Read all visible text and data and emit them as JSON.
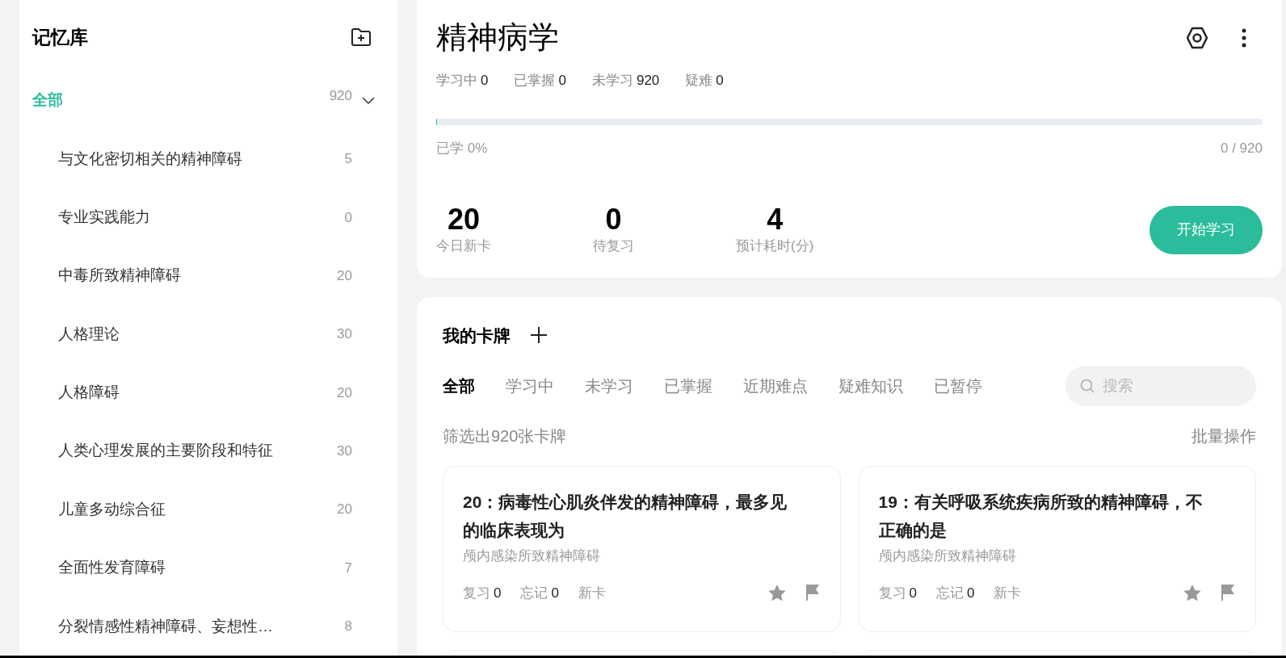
{
  "sidebar": {
    "title": "记忆库",
    "items": [
      {
        "label": "全部",
        "count": "920",
        "selected": true,
        "expanded": true,
        "children": [
          {
            "label": "与文化密切相关的精神障碍",
            "count": "5",
            "selected": false
          },
          {
            "label": "专业实践能力",
            "count": "0",
            "selected": false
          },
          {
            "label": "中毒所致精神障碍",
            "count": "20",
            "selected": false
          },
          {
            "label": "人格理论",
            "count": "30",
            "selected": false
          },
          {
            "label": "人格障碍",
            "count": "20",
            "selected": false
          },
          {
            "label": "人类心理发展的主要阶段和特征",
            "count": "30",
            "selected": false
          },
          {
            "label": "儿童多动综合征",
            "count": "20",
            "selected": false
          },
          {
            "label": "全面性发育障碍",
            "count": "7",
            "selected": false
          },
          {
            "label": "分裂情感性精神障碍、妄想性…",
            "count": "8",
            "selected": false
          }
        ]
      }
    ]
  },
  "deck": {
    "title": "精神病学",
    "stats": [
      {
        "label": "学习中",
        "value": "0"
      },
      {
        "label": "已掌握",
        "value": "0"
      },
      {
        "label": "未学习",
        "value": "920"
      },
      {
        "label": "疑难",
        "value": "0"
      }
    ],
    "progress": {
      "level": 0,
      "label": "已学 0%",
      "reading": "0 / 920"
    },
    "summary": [
      {
        "value": "20",
        "label": "今日新卡"
      },
      {
        "value": "0",
        "label": "待复习"
      },
      {
        "value": "4",
        "label": "预计耗时(分)"
      }
    ],
    "start_button": "开始学习"
  },
  "cards_panel": {
    "title": "我的卡牌",
    "tabs": [
      {
        "label": "全部",
        "selected": true
      },
      {
        "label": "学习中",
        "selected": false
      },
      {
        "label": "未学习",
        "selected": false
      },
      {
        "label": "已掌握",
        "selected": false
      },
      {
        "label": "近期难点",
        "selected": false
      },
      {
        "label": "疑难知识",
        "selected": false
      },
      {
        "label": "已暂停",
        "selected": false
      }
    ],
    "search": {
      "placeholder": "搜索"
    },
    "filter_text": "筛选出920张卡牌",
    "bulk_action": "批量操作",
    "cards": [
      {
        "title": "20：病毒性心肌炎伴发的精神障碍，最多见的临床表现为",
        "category": "颅内感染所致精神障碍",
        "stats": [
          {
            "label": "复习",
            "value": "0"
          },
          {
            "label": "忘记",
            "value": "0"
          }
        ],
        "status": "新卡",
        "starred": false,
        "flagged": false
      },
      {
        "title": "19：有关呼吸系统疾病所致的精神障碍，不正确的是",
        "category": "颅内感染所致精神障碍",
        "stats": [
          {
            "label": "复习",
            "value": "0"
          },
          {
            "label": "忘记",
            "value": "0"
          }
        ],
        "status": "新卡",
        "starred": false,
        "flagged": false
      }
    ]
  }
}
